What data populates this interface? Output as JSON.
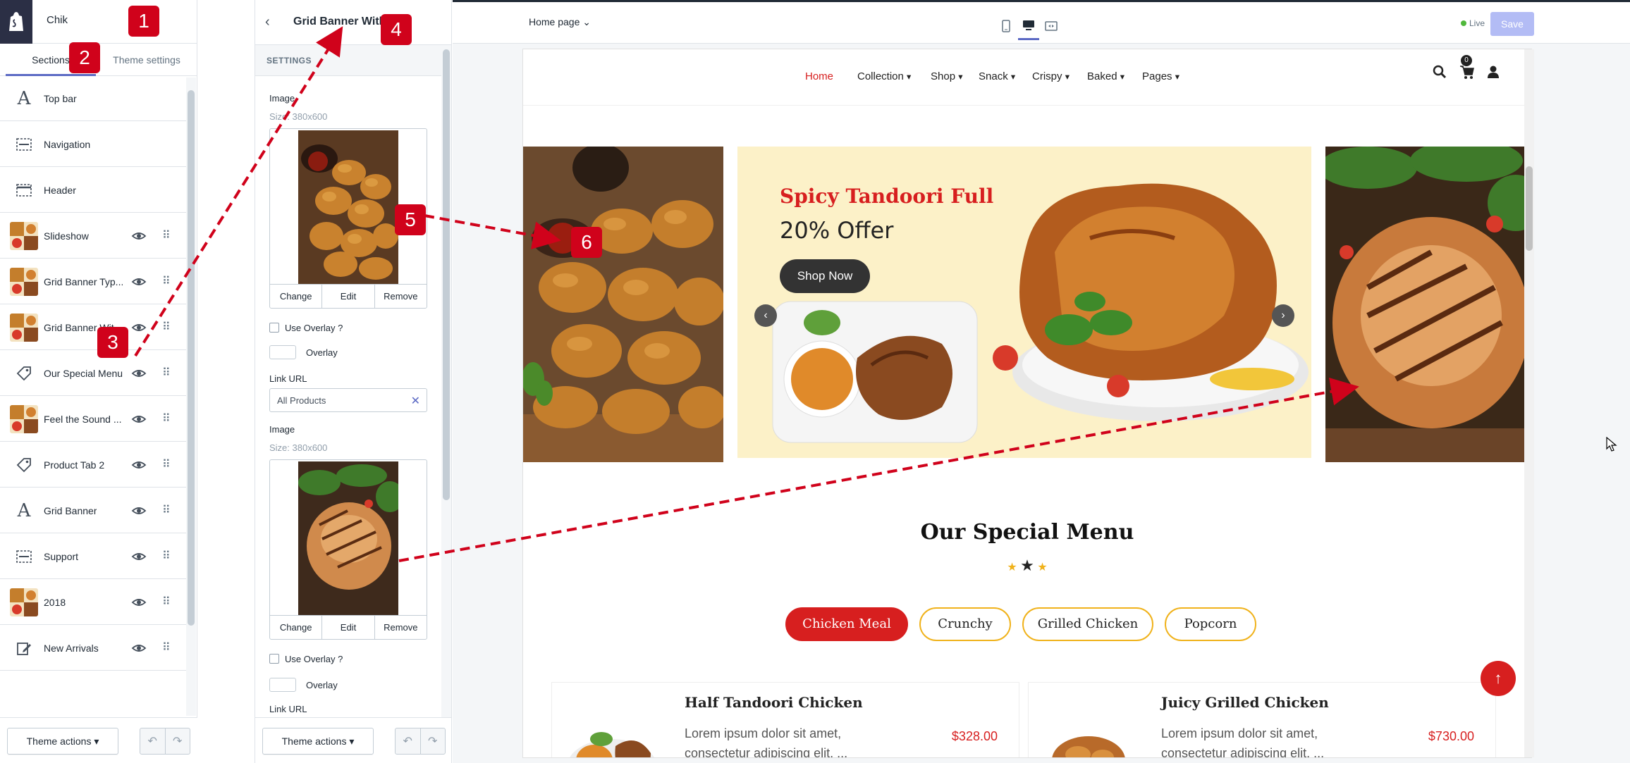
{
  "app": {
    "shop_name": "Chik"
  },
  "sidebar": {
    "tabs": [
      "Sections",
      "Theme settings"
    ],
    "items": [
      {
        "label": "Top bar",
        "icon": "text-icon",
        "eye": false
      },
      {
        "label": "Navigation",
        "icon": "navigation-icon",
        "eye": false
      },
      {
        "label": "Header",
        "icon": "header-icon",
        "eye": false
      },
      {
        "label": "Slideshow",
        "icon": "thumbnail",
        "eye": true
      },
      {
        "label": "Grid Banner Typ...",
        "icon": "thumbnail",
        "eye": true
      },
      {
        "label": "Grid Banner Wit...",
        "icon": "thumbnail",
        "eye": true
      },
      {
        "label": "Our Special Menu",
        "icon": "tag-icon",
        "eye": true
      },
      {
        "label": "Feel the Sound ...",
        "icon": "thumbnail",
        "eye": true
      },
      {
        "label": "Product Tab 2",
        "icon": "tag-icon",
        "eye": true
      },
      {
        "label": "Grid Banner",
        "icon": "text-icon",
        "eye": true
      },
      {
        "label": "Support",
        "icon": "navigation-icon",
        "eye": true
      },
      {
        "label": "2018",
        "icon": "thumbnail",
        "eye": true
      },
      {
        "label": "New Arrivals",
        "icon": "edit-icon",
        "eye": true
      }
    ],
    "footer": {
      "theme_actions": "Theme actions"
    }
  },
  "settings": {
    "title": "Grid Banner With",
    "section_label": "SETTINGS",
    "image1": {
      "label": "Image",
      "size": "Size: 380x600",
      "buttons": [
        "Change",
        "Edit",
        "Remove"
      ]
    },
    "overlay1": {
      "checkbox": "Use Overlay ?",
      "swatch": "Overlay"
    },
    "link1": {
      "label": "Link URL",
      "value": "All Products"
    },
    "image2": {
      "label": "Image",
      "size": "Size: 380x600",
      "buttons": [
        "Change",
        "Edit",
        "Remove"
      ]
    },
    "overlay2": {
      "checkbox": "Use Overlay ?",
      "swatch": "Overlay"
    },
    "link2": {
      "label": "Link URL"
    },
    "footer": {
      "theme_actions": "Theme actions"
    }
  },
  "topbar": {
    "page": "Home page",
    "live": "Live",
    "save": "Save"
  },
  "preview": {
    "nav": [
      "Home",
      "Collection",
      "Shop",
      "Snack",
      "Crispy",
      "Baked",
      "Pages"
    ],
    "cart_count": "0",
    "slide": {
      "title": "Spicy Tandoori Full",
      "offer": "20% Offer",
      "button": "Shop Now"
    },
    "menu": {
      "title": "Our Special Menu",
      "tabs": [
        "Chicken Meal",
        "Crunchy",
        "Grilled Chicken",
        "Popcorn"
      ],
      "cards": [
        {
          "name": "Half Tandoori Chicken",
          "desc": "Lorem ipsum dolor sit amet, consectetur adipiscing elit. ...",
          "price": "$328.00"
        },
        {
          "name": "Juicy Grilled Chicken",
          "desc": "Lorem ipsum dolor sit amet, consectetur adipiscing elit. ...",
          "price": "$730.00"
        }
      ]
    }
  },
  "annotations": [
    "1",
    "2",
    "3",
    "4",
    "5",
    "6"
  ],
  "colors": {
    "accent": "#d71f1f",
    "badge": "#d0021b",
    "shopify_purple": "#5c6ac4",
    "banner_bg": "#fcf1c8"
  }
}
